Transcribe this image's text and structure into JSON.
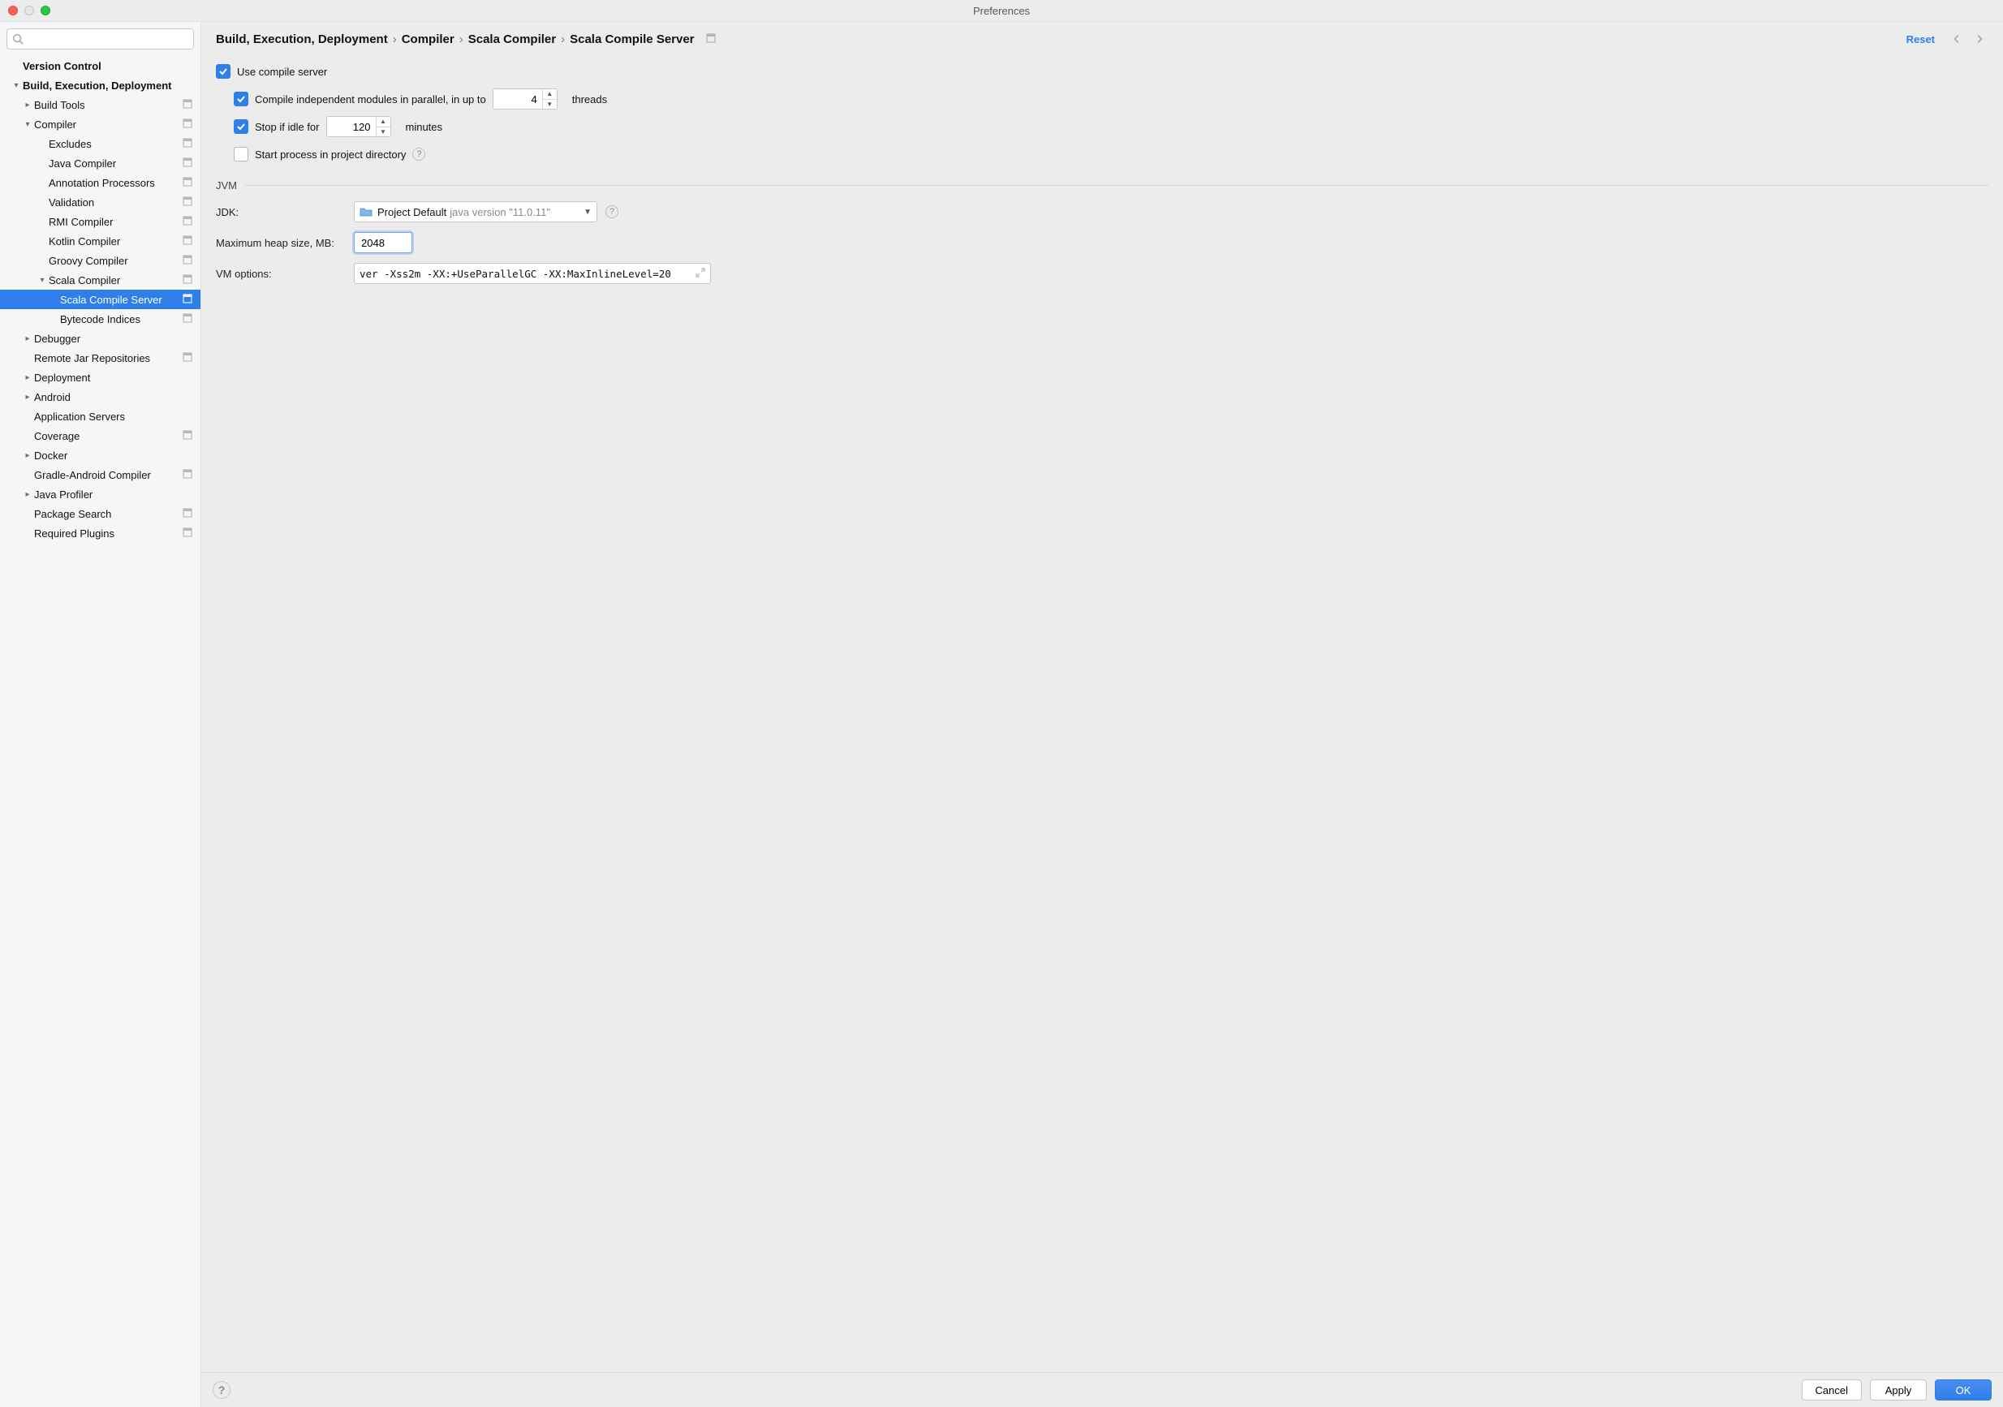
{
  "window": {
    "title": "Preferences"
  },
  "sidebar": {
    "search_placeholder": "",
    "items": {
      "version_control": "Version Control",
      "bed": "Build, Execution, Deployment",
      "build_tools": "Build Tools",
      "compiler": "Compiler",
      "excludes": "Excludes",
      "java_compiler": "Java Compiler",
      "annotation_processors": "Annotation Processors",
      "validation": "Validation",
      "rmi_compiler": "RMI Compiler",
      "kotlin_compiler": "Kotlin Compiler",
      "groovy_compiler": "Groovy Compiler",
      "scala_compiler": "Scala Compiler",
      "scala_compile_server": "Scala Compile Server",
      "bytecode_indices": "Bytecode Indices",
      "debugger": "Debugger",
      "remote_jar": "Remote Jar Repositories",
      "deployment": "Deployment",
      "android": "Android",
      "application_servers": "Application Servers",
      "coverage": "Coverage",
      "docker": "Docker",
      "gradle_android": "Gradle-Android Compiler",
      "java_profiler": "Java Profiler",
      "package_search": "Package Search",
      "required_plugins": "Required Plugins"
    }
  },
  "breadcrumb": {
    "c0": "Build, Execution, Deployment",
    "c1": "Compiler",
    "c2": "Scala Compiler",
    "c3": "Scala Compile Server",
    "reset": "Reset"
  },
  "form": {
    "use_compile_server": "Use compile server",
    "compile_parallel_prefix": "Compile independent modules in parallel, in up to",
    "compile_parallel_suffix": "threads",
    "compile_parallel_value": "4",
    "stop_idle_prefix": "Stop if idle for",
    "stop_idle_suffix": "minutes",
    "stop_idle_value": "120",
    "start_project_dir": "Start process in project directory",
    "jvm_title": "JVM",
    "jdk_label": "JDK:",
    "jdk_main": "Project Default",
    "jdk_detail": "java version \"11.0.11\"",
    "heap_label": "Maximum heap size, MB:",
    "heap_value": "2048",
    "vm_label": "VM options:",
    "vm_value": "ver -Xss2m -XX:+UseParallelGC -XX:MaxInlineLevel=20"
  },
  "footer": {
    "cancel": "Cancel",
    "apply": "Apply",
    "ok": "OK"
  }
}
